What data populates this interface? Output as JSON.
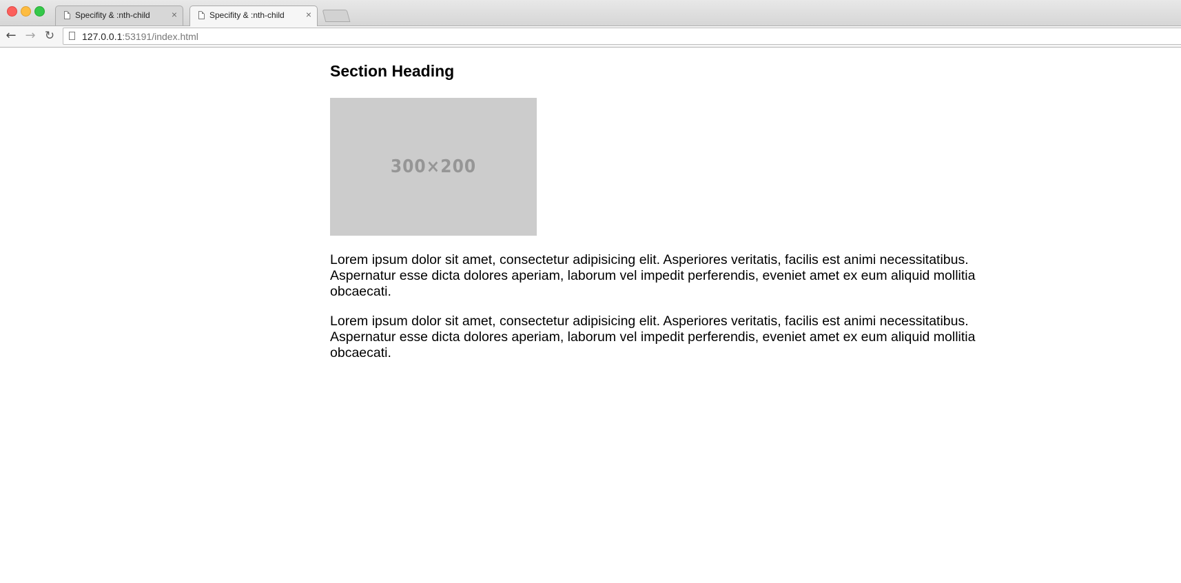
{
  "browser": {
    "tabs": [
      {
        "title": "Specifity & :nth-child",
        "close": "×",
        "active": false
      },
      {
        "title": "Specifity & :nth-child",
        "close": "×",
        "active": true
      }
    ],
    "nav": {
      "back": "←",
      "forward": "→",
      "reload": "↻"
    },
    "address": {
      "host": "127.0.0.1",
      "rest": ":53191/index.html"
    }
  },
  "page": {
    "heading": "Section Heading",
    "image_label": "300×200",
    "paragraphs": [
      "Lorem ipsum dolor sit amet, consectetur adipisicing elit. Asperiores veritatis, facilis est animi necessitatibus. Aspernatur esse dicta dolores aperiam, laborum vel impedit perferendis, eveniet amet ex eum aliquid mollitia obcaecati.",
      "Lorem ipsum dolor sit amet, consectetur adipisicing elit. Asperiores veritatis, facilis est animi necessitatibus. Aspernatur esse dicta dolores aperiam, laborum vel impedit perferendis, eveniet amet ex eum aliquid mollitia obcaecati."
    ]
  }
}
